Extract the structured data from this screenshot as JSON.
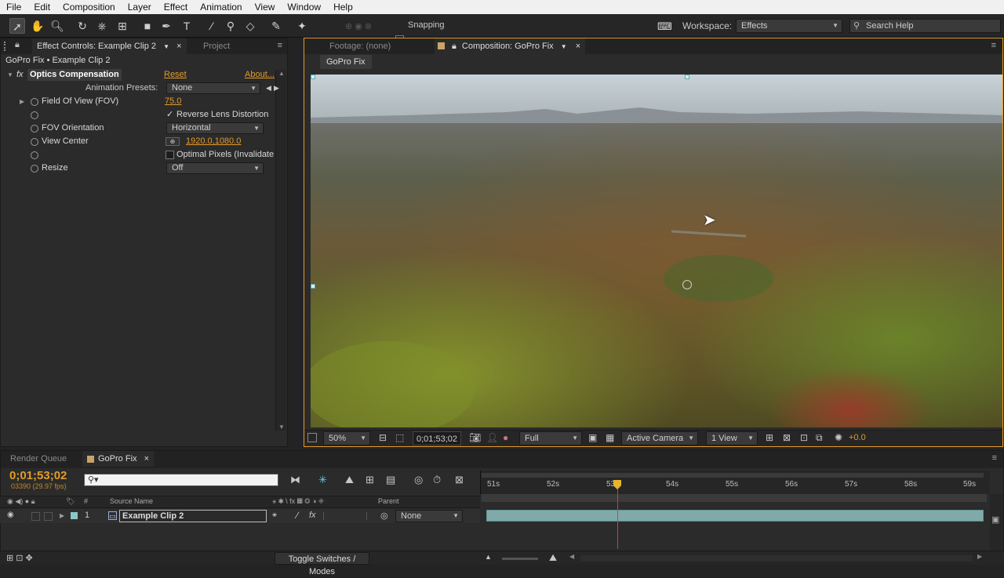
{
  "menu": [
    "File",
    "Edit",
    "Composition",
    "Layer",
    "Effect",
    "Animation",
    "View",
    "Window",
    "Help"
  ],
  "toolbar": {
    "snapping_label": "Snapping",
    "workspace_label": "Workspace:",
    "workspace_value": "Effects",
    "search_placeholder": "Search Help"
  },
  "effect_panel": {
    "tab_effect_controls": "Effect Controls: Example Clip 2",
    "tab_project": "Project",
    "breadcrumb": "GoPro Fix • Example Clip 2",
    "effect_name": "Optics Compensation",
    "reset": "Reset",
    "about": "About...",
    "fx_badge": "fx",
    "animation_presets_label": "Animation Presets:",
    "animation_presets_value": "None",
    "props": {
      "fov_label": "Field Of View (FOV)",
      "fov_value": "75.0",
      "reverse_label": "Reverse Lens Distortion",
      "fov_orient_label": "FOV Orientation",
      "fov_orient_value": "Horizontal",
      "view_center_label": "View Center",
      "view_center_value": "1920.0,1080.0",
      "optimal_label": "Optimal Pixels (Invalidate",
      "resize_label": "Resize",
      "resize_value": "Off"
    }
  },
  "viewer": {
    "tab_footage": "Footage: (none)",
    "tab_composition": "Composition: GoPro Fix",
    "comp_name": "GoPro Fix",
    "zoom": "50%",
    "timecode": "0;01;53;02",
    "resolution": "Full",
    "camera": "Active Camera",
    "view_layout": "1 View",
    "exposure": "+0.0"
  },
  "timeline": {
    "tab_render_queue": "Render Queue",
    "tab_comp": "GoPro Fix",
    "current_time": "0;01;53;02",
    "frame_info": "03390 (29.97 fps)",
    "search_placeholder": "",
    "col_number": "#",
    "col_source_name": "Source Name",
    "col_parent": "Parent",
    "ruler": [
      "51s",
      "52s",
      "53s",
      "54s",
      "55s",
      "56s",
      "57s",
      "58s",
      "59s"
    ],
    "layers": [
      {
        "index": "1",
        "name": "Example Clip 2",
        "parent": "None"
      }
    ],
    "toggle_label": "Toggle Switches / Modes"
  },
  "colors": {
    "accent_orange": "#e39b2a",
    "playhead_red": "#e23a2a",
    "layer_bar": "#8ab8b8"
  }
}
